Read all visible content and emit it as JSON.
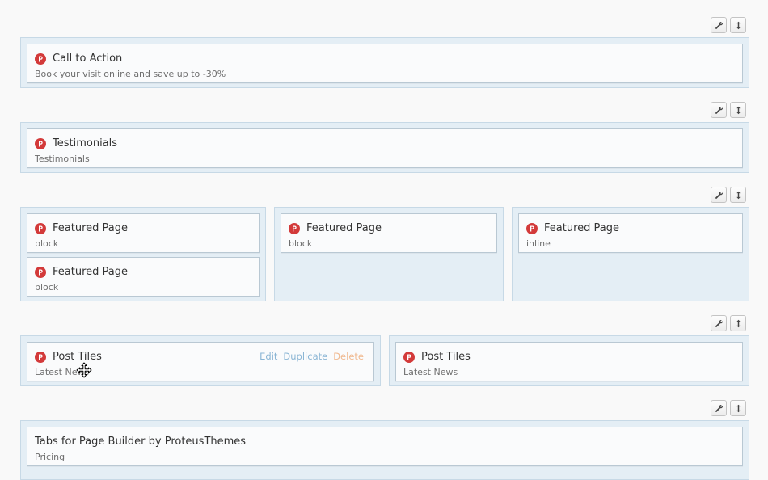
{
  "icons": {
    "widget_icon": "proteus-p-icon",
    "settings": "wrench-icon",
    "move": "vertical-move-icon",
    "cursor": "move-cursor-icon"
  },
  "colors": {
    "accent_red": "#d33a3a",
    "cell_bg": "#e4eef5",
    "edit_link": "#8ab5d4",
    "delete_link": "#f0b98f"
  },
  "rows": {
    "cta": {
      "widget": {
        "title": "Call to Action",
        "subtitle": "Book your visit online and save up to -30%"
      }
    },
    "testimonials": {
      "widget": {
        "title": "Testimonials",
        "subtitle": "Testimonials"
      }
    },
    "featured": {
      "col1": [
        {
          "title": "Featured Page",
          "subtitle": "block"
        },
        {
          "title": "Featured Page",
          "subtitle": "block"
        }
      ],
      "col2": [
        {
          "title": "Featured Page",
          "subtitle": "block"
        }
      ],
      "col3": [
        {
          "title": "Featured Page",
          "subtitle": "inline"
        }
      ]
    },
    "posts": {
      "col1": [
        {
          "title": "Post Tiles",
          "subtitle": "Latest News",
          "actions": {
            "edit": "Edit",
            "duplicate": "Duplicate",
            "delete": "Delete"
          }
        }
      ],
      "col2": [
        {
          "title": "Post Tiles",
          "subtitle": "Latest News"
        }
      ]
    },
    "tabs": {
      "widget": {
        "title": "Tabs for Page Builder by ProteusThemes",
        "subtitle": "Pricing"
      }
    }
  }
}
